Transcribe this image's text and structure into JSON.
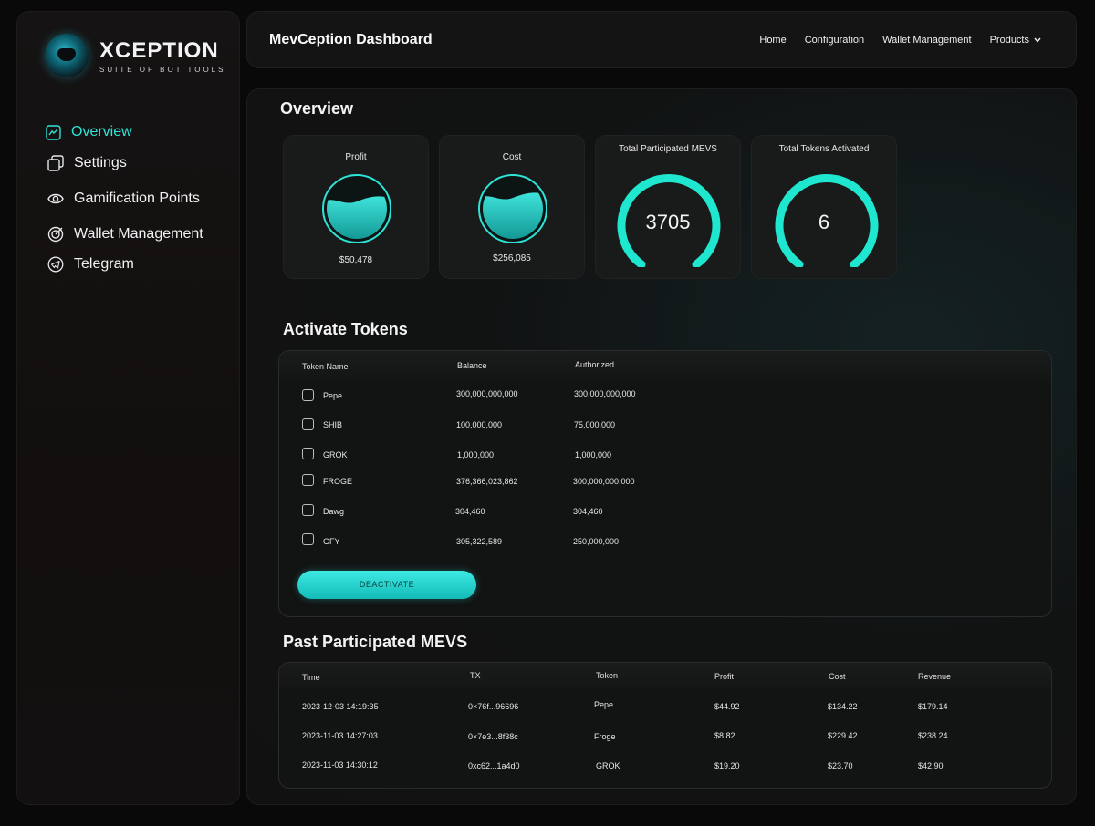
{
  "brand": {
    "title": "XCEPTION",
    "subtitle": "SUITE OF BOT TOOLS"
  },
  "sidebar": {
    "items": [
      {
        "label": "Overview",
        "icon": "chart-icon",
        "active": true
      },
      {
        "label": "Settings",
        "icon": "copy-icon",
        "active": false
      },
      {
        "label": "Gamification Points",
        "icon": "eye-icon",
        "active": false
      },
      {
        "label": "Wallet Management",
        "icon": "target-icon",
        "active": false
      },
      {
        "label": "Telegram",
        "icon": "telegram-icon",
        "active": false
      }
    ]
  },
  "header": {
    "title": "MevCeption Dashboard",
    "nav": [
      "Home",
      "Configuration",
      "Wallet Management",
      "Products"
    ]
  },
  "overview": {
    "title": "Overview",
    "cards": [
      {
        "label": "Profit",
        "value": "$50,478"
      },
      {
        "label": "Cost",
        "value": "$256,085"
      },
      {
        "label": "Total Participated MEVS",
        "value": "3705"
      },
      {
        "label": "Total Tokens Activated",
        "value": "6"
      }
    ]
  },
  "activate": {
    "title": "Activate Tokens",
    "columns": [
      "Token Name",
      "Balance",
      "Authorized"
    ],
    "rows": [
      {
        "name": "Pepe",
        "balance": "300,000,000,000",
        "authorized": "300,000,000,000"
      },
      {
        "name": "SHIB",
        "balance": "100,000,000",
        "authorized": "75,000,000"
      },
      {
        "name": "GROK",
        "balance": "1,000,000",
        "authorized": "1,000,000"
      },
      {
        "name": "FROGE",
        "balance": "376,366,023,862",
        "authorized": "300,000,000,000"
      },
      {
        "name": "Dawg",
        "balance": "304,460",
        "authorized": "304,460"
      },
      {
        "name": "GFY",
        "balance": "305,322,589",
        "authorized": "250,000,000"
      }
    ],
    "button": "DEACTIVATE"
  },
  "past": {
    "title": "Past Participated MEVS",
    "columns": [
      "Time",
      "TX",
      "Token",
      "Profit",
      "Cost",
      "Revenue"
    ],
    "rows": [
      [
        "2023-12-03 14:19:35",
        "0×76f...96696",
        "Pepe",
        "$44.92",
        "$134.22",
        "$179.14"
      ],
      [
        "2023-11-03 14:27:03",
        "0×7e3...8f38c",
        "Froge",
        "$8.82",
        "$229.42",
        "$238.24"
      ],
      [
        "2023-11-03 14:30:12",
        "0xc62...1a4d0",
        "GROK",
        "$19.20",
        "$23.70",
        "$42.90"
      ]
    ]
  },
  "colors": {
    "accent": "#2ee4d6",
    "background": "#090909"
  }
}
